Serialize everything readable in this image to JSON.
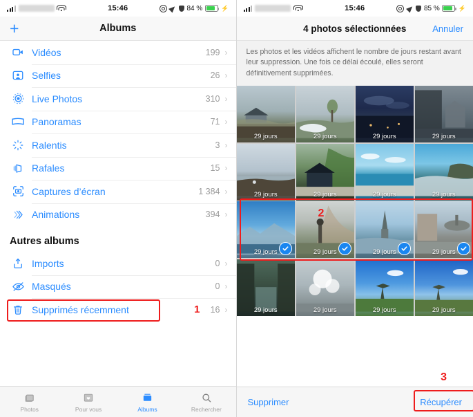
{
  "left": {
    "status": {
      "time": "15:46",
      "battery_pct": "84 %",
      "wifi": "wifi-icon",
      "signal": "cellular-signal-icon"
    },
    "nav": {
      "add_label": "+",
      "title": "Albums"
    },
    "albums": [
      {
        "label": "Vidéos",
        "count": "199",
        "icon": "video-icon"
      },
      {
        "label": "Selfies",
        "count": "26",
        "icon": "selfie-icon"
      },
      {
        "label": "Live Photos",
        "count": "310",
        "icon": "live-photo-icon"
      },
      {
        "label": "Panoramas",
        "count": "71",
        "icon": "panorama-icon"
      },
      {
        "label": "Ralentis",
        "count": "3",
        "icon": "slomo-icon"
      },
      {
        "label": "Rafales",
        "count": "15",
        "icon": "burst-icon"
      },
      {
        "label": "Captures d’écran",
        "count": "1 384",
        "icon": "screenshot-icon"
      },
      {
        "label": "Animations",
        "count": "394",
        "icon": "animated-icon"
      }
    ],
    "section_title": "Autres albums",
    "other_albums": [
      {
        "label": "Imports",
        "count": "0",
        "icon": "import-icon"
      },
      {
        "label": "Masqués",
        "count": "0",
        "icon": "hidden-eye-icon"
      },
      {
        "label": "Supprimés récemment",
        "count": "16",
        "icon": "trash-icon"
      }
    ],
    "marker_1": "1",
    "tabs": [
      {
        "label": "Photos",
        "icon": "photos-icon",
        "active": false
      },
      {
        "label": "Pour vous",
        "icon": "for-you-icon",
        "active": false
      },
      {
        "label": "Albums",
        "icon": "albums-icon",
        "active": true
      },
      {
        "label": "Rechercher",
        "icon": "search-icon",
        "active": false
      }
    ]
  },
  "right": {
    "status": {
      "time": "15:46",
      "battery_pct": "85 %"
    },
    "nav": {
      "title": "4 photos sélectionnées",
      "cancel": "Annuler"
    },
    "description": "Les photos et les vidéos affichent le nombre de jours restant avant leur suppression. Une fois ce délai écoulé, elles seront définitivement supprimées.",
    "days_label": "29 jours",
    "photos": [
      {
        "id": "photo-r1c1",
        "selected": false
      },
      {
        "id": "photo-r1c2",
        "selected": false
      },
      {
        "id": "photo-r1c3",
        "selected": false
      },
      {
        "id": "photo-r1c4",
        "selected": false
      },
      {
        "id": "photo-r2c1",
        "selected": false
      },
      {
        "id": "photo-r2c2",
        "selected": false
      },
      {
        "id": "photo-r2c3",
        "selected": false
      },
      {
        "id": "photo-r2c4",
        "selected": false
      },
      {
        "id": "photo-r3c1",
        "selected": true
      },
      {
        "id": "photo-r3c2",
        "selected": true
      },
      {
        "id": "photo-r3c3",
        "selected": true
      },
      {
        "id": "photo-r3c4",
        "selected": true
      },
      {
        "id": "photo-r4c1",
        "selected": false
      },
      {
        "id": "photo-r4c2",
        "selected": false
      },
      {
        "id": "photo-r4c3",
        "selected": false
      },
      {
        "id": "photo-r4c4",
        "selected": false
      }
    ],
    "marker_2": "2",
    "marker_3": "3",
    "bottom": {
      "delete": "Supprimer",
      "recover": "Récupérer"
    }
  },
  "accent": "#2b8cff",
  "annotation_color": "#ee1c1c"
}
